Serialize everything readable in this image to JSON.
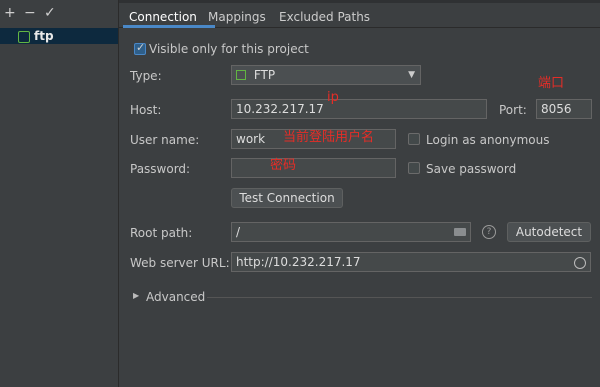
{
  "toolbar": {
    "add": "+",
    "remove": "−",
    "apply": "✓"
  },
  "servers": [
    {
      "name": "ftp",
      "icon": "ftp-server-icon"
    }
  ],
  "tabs": [
    "Connection",
    "Mappings",
    "Excluded Paths"
  ],
  "connection": {
    "visible_only_label": "Visible only for this project",
    "visible_only_checked": true,
    "type_label": "Type:",
    "type_value": "FTP",
    "host_label": "Host:",
    "host_value": "10.232.217.17",
    "port_label": "Port:",
    "port_value": "8056",
    "username_label": "User name:",
    "username_value": "work",
    "anonymous_label": "Login as anonymous",
    "password_label": "Password:",
    "password_value": "",
    "save_password_label": "Save password",
    "test_button": "Test Connection",
    "root_label": "Root path:",
    "root_value": "/",
    "autodetect_button": "Autodetect",
    "url_label": "Web server URL:",
    "url_value": "http://10.232.217.17",
    "advanced_label": "Advanced"
  },
  "annotations": {
    "port_note": "端口",
    "ip_note": "ip",
    "user_note": "当前登陆用户名",
    "password_note": "密码"
  },
  "colors": {
    "accent": "#4a88c7",
    "annotation": "#e52d27",
    "selection": "#0d293e"
  }
}
